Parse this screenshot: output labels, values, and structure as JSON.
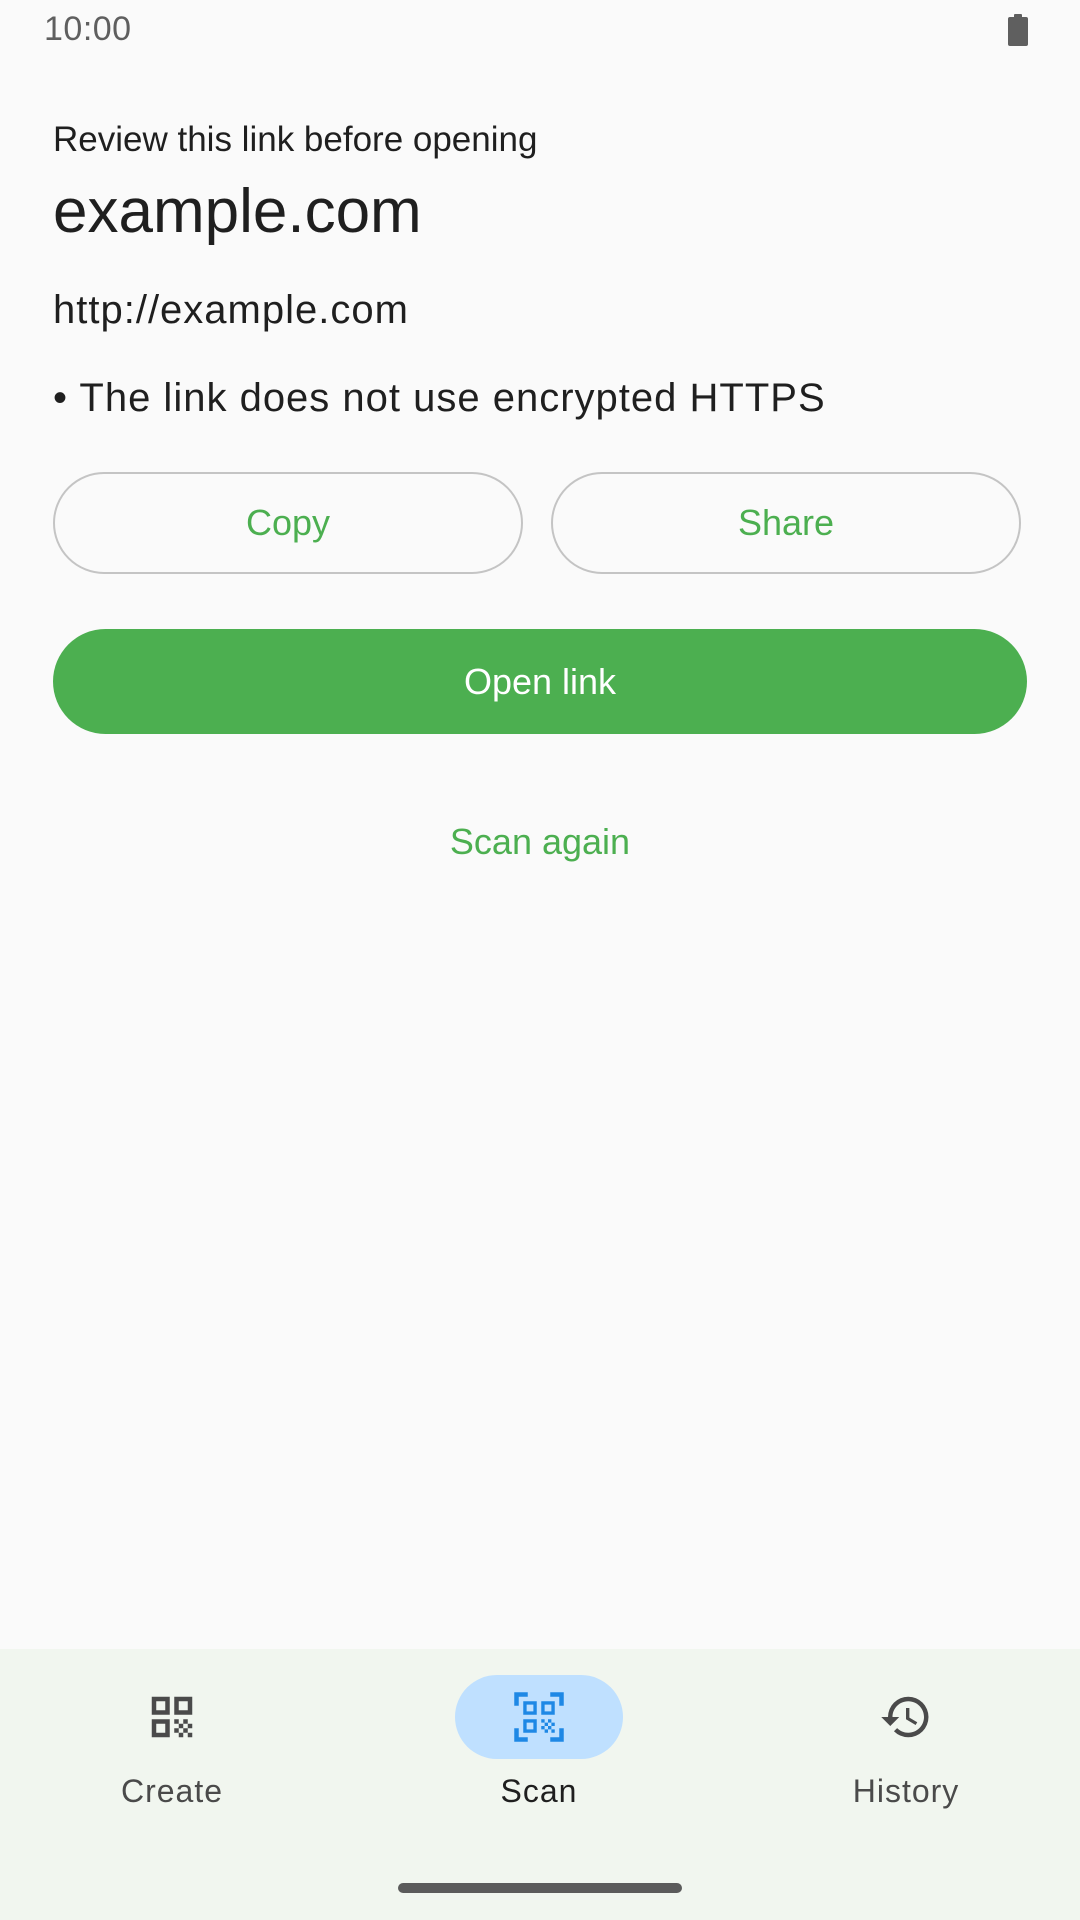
{
  "status_bar": {
    "time": "10:00",
    "battery_icon": "battery-full-icon"
  },
  "review": {
    "subtitle": "Review this link before opening",
    "domain": "example.com",
    "url": "http://example.com",
    "warnings": [
      "• The link does not use encrypted HTTPS"
    ]
  },
  "actions": {
    "copy_label": "Copy",
    "share_label": "Share",
    "open_label": "Open link",
    "scan_again_label": "Scan again"
  },
  "bottom_nav": {
    "selected": "Scan",
    "items": [
      {
        "label": "Create",
        "icon": "qr-code-icon"
      },
      {
        "label": "Scan",
        "icon": "qr-scanner-icon"
      },
      {
        "label": "History",
        "icon": "history-icon"
      }
    ]
  },
  "colors": {
    "accent": "#4caf50",
    "nav_indicator": "#bfe0ff",
    "scan_icon": "#1e88e5",
    "background": "#fafafa",
    "nav_background": "#f1f6ef"
  }
}
